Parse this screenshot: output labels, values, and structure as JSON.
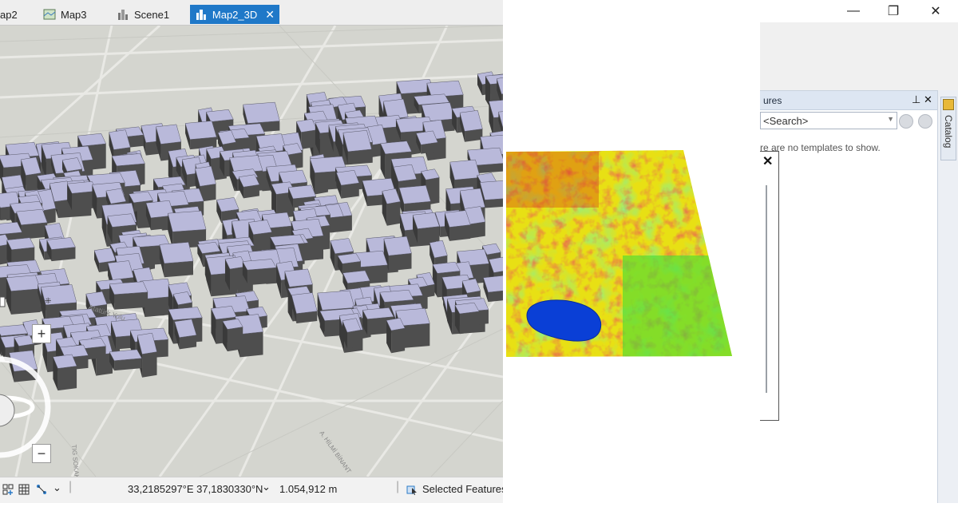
{
  "tabs": [
    {
      "label": "ap2",
      "icon": "map-icon",
      "active": false
    },
    {
      "label": "Map3",
      "icon": "map-icon",
      "active": false
    },
    {
      "label": "Scene1",
      "icon": "scene-icon",
      "active": false
    },
    {
      "label": "Map2_3D",
      "icon": "scene-icon",
      "active": true
    }
  ],
  "scene": {
    "streets": [
      "Atatürk Yolu",
      "TIG SOKAK",
      "A. HİLMİ BİNANT"
    ],
    "zoom_in": "+",
    "zoom_out": "−"
  },
  "status": {
    "coordinates": "33,2185297°E 37,1830330°N",
    "scale_dropdown": "⌄",
    "scale": "1.054,912 m",
    "selected_features": "Selected Features"
  },
  "window": {
    "minimize": "—",
    "restore": "❐",
    "close": "✕"
  },
  "pane": {
    "title": "ures",
    "pin": "📌",
    "close": "✕",
    "search_placeholder": "<Search>",
    "empty_message": "re are no templates to show.",
    "dialog_close": "✕",
    "catalog_label": "Catalog"
  },
  "raster": {
    "lake_color": "#0a3fd6",
    "colors": [
      "#d22a12",
      "#e8e014",
      "#4fdb32"
    ]
  }
}
